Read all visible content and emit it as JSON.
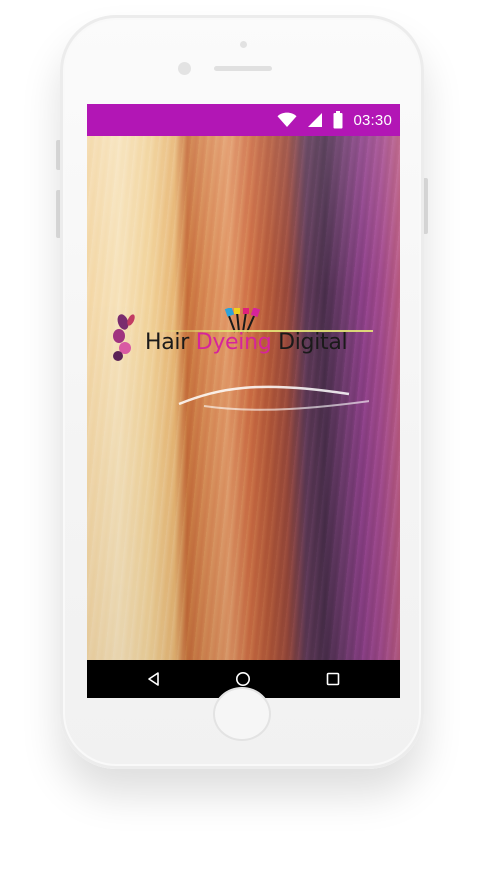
{
  "status_bar": {
    "time": "03:30",
    "background_color": "#b216b5",
    "icons": [
      "wifi-icon",
      "signal-icon",
      "battery-icon"
    ]
  },
  "logo": {
    "word_hair": "Hair ",
    "word_dyeing": "Dyeing",
    "word_digital": " Digital",
    "accent_color": "#d6249b"
  },
  "background_image": "hair-color-swatches",
  "nav_bar": {
    "buttons": [
      "back-icon",
      "home-icon",
      "recents-icon"
    ]
  }
}
